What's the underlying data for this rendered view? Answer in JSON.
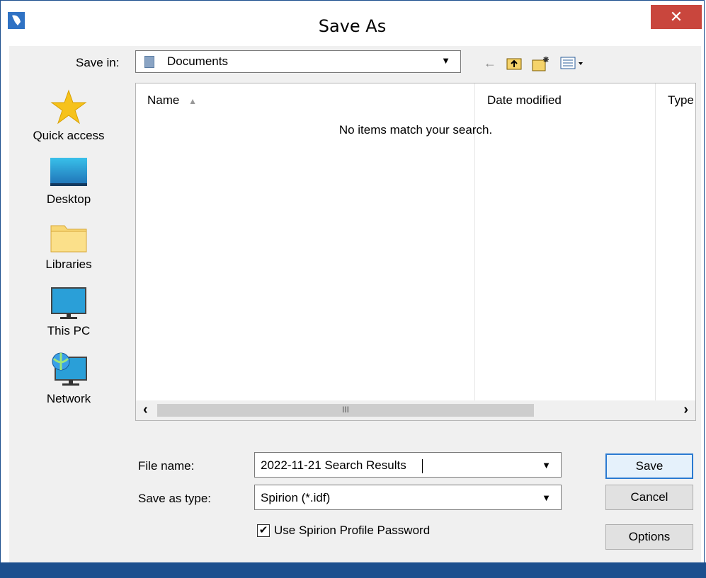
{
  "window": {
    "title": "Save As",
    "close_glyph": "✕"
  },
  "toolbar": {
    "save_in_label": "Save in:",
    "save_in_value": "Documents",
    "back_icon": "←",
    "up_icon": "⬆",
    "new_folder_icon": "✱",
    "view_icon": "▦▾"
  },
  "sidebar": {
    "items": [
      {
        "label": "Quick access",
        "icon": "star-icon"
      },
      {
        "label": "Desktop",
        "icon": "desktop-icon"
      },
      {
        "label": "Libraries",
        "icon": "folder-icon"
      },
      {
        "label": "This PC",
        "icon": "monitor-icon"
      },
      {
        "label": "Network",
        "icon": "network-icon"
      }
    ]
  },
  "filelist": {
    "columns": [
      "Name",
      "Date modified",
      "Type"
    ],
    "sort_indicator": "▲",
    "empty_message": "No items match your search.",
    "scroll_left": "‹",
    "scroll_right": "›",
    "scroll_grip": "III"
  },
  "form": {
    "file_name_label": "File name:",
    "file_name_value": "2022-11-21 Search Results",
    "type_label": "Save as type:",
    "type_value": "Spirion (*.idf)",
    "checkbox_label": "Use Spirion Profile Password",
    "checkbox_checked": true
  },
  "buttons": {
    "save": "Save",
    "cancel": "Cancel",
    "options": "Options"
  },
  "colors": {
    "accent": "#2a7ad1",
    "close": "#c9463d",
    "border": "#1c4f8e"
  }
}
